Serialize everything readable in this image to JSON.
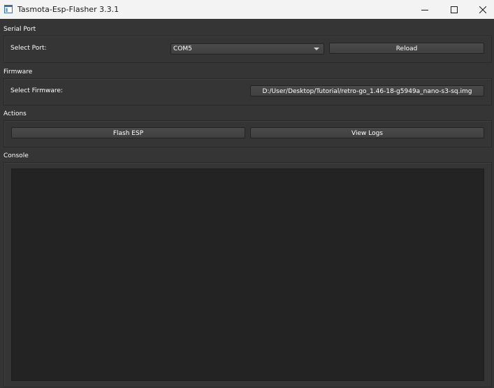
{
  "window": {
    "title": "Tasmota-Esp-Flasher 3.3.1",
    "icon": "app-window-icon",
    "controls": [
      "minimize-icon",
      "maximize-icon",
      "close-icon"
    ]
  },
  "serial_port": {
    "group_title": "Serial Port",
    "label": "Select Port:",
    "selected_port": "COM5",
    "reload_label": "Reload"
  },
  "firmware": {
    "group_title": "Firmware",
    "label": "Select Firmware:",
    "file_path": "D:/User/Desktop/Tutorial/retro-go_1.46-18-g5949a_nano-s3-sq.img"
  },
  "actions": {
    "group_title": "Actions",
    "flash_label": "Flash ESP",
    "logs_label": "View Logs"
  },
  "console": {
    "group_title": "Console",
    "content": ""
  },
  "colors": {
    "window_bg": "#353535",
    "titlebar_bg": "#f3f3f3",
    "console_bg": "#232323",
    "button_bg": "#444444"
  }
}
